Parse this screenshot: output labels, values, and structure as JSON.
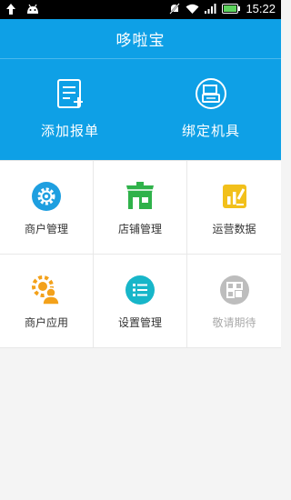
{
  "status_bar": {
    "time": "15:22",
    "icons": [
      "upload-icon",
      "android-icon",
      "mute-icon",
      "wifi-icon",
      "signal-icon",
      "battery-icon"
    ]
  },
  "app": {
    "title": "哆啦宝",
    "accent_color": "#0ea0e6"
  },
  "actions": [
    {
      "label": "添加报单",
      "icon": "document-icon"
    },
    {
      "label": "绑定机具",
      "icon": "pos-machine-icon"
    }
  ],
  "grid": [
    {
      "label": "商户管理",
      "icon": "gear-icon",
      "color": "#1e9fe0",
      "enabled": true
    },
    {
      "label": "店铺管理",
      "icon": "store-icon",
      "color": "#2fb24a",
      "enabled": true
    },
    {
      "label": "运营数据",
      "icon": "chart-icon",
      "color": "#f2c01b",
      "enabled": true
    },
    {
      "label": "商户应用",
      "icon": "user-gear-icon",
      "color": "#f3a11a",
      "enabled": true
    },
    {
      "label": "设置管理",
      "icon": "list-icon",
      "color": "#17b6c9",
      "enabled": true
    },
    {
      "label": "敬请期待",
      "icon": "grid-icon",
      "color": "#bdbdbd",
      "enabled": false
    }
  ]
}
